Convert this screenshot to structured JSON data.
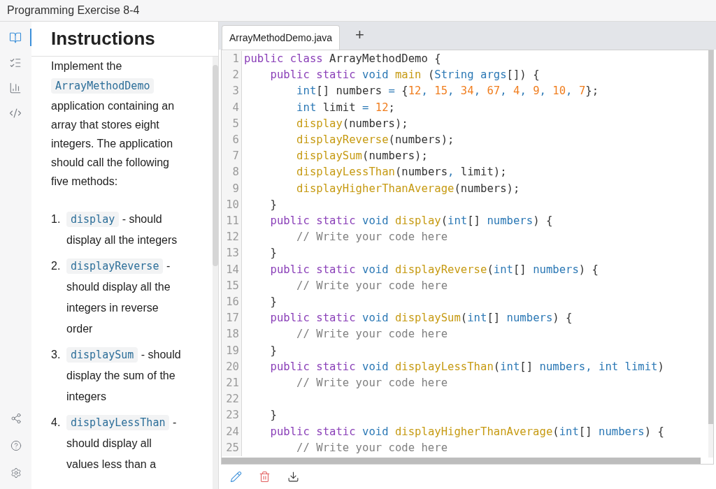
{
  "window": {
    "title": "Programming Exercise 8-4"
  },
  "rail": {
    "top": [
      {
        "selected": true
      },
      {
        "selected": false
      },
      {
        "selected": false
      },
      {
        "selected": false
      }
    ]
  },
  "instructions": {
    "heading": "Instructions",
    "intro_before": "Implement the",
    "intro_code": "ArrayMethodDemo",
    "intro_after": "application containing an array that stores eight integers. The application should call the following five methods:",
    "items": [
      {
        "number": "1.",
        "method": "display",
        "text": "- should display all the integers"
      },
      {
        "number": "2.",
        "method": "displayReverse",
        "text": "- should display all the integers in reverse order"
      },
      {
        "number": "3.",
        "method": "displaySum",
        "text": "- should display the sum of the integers"
      },
      {
        "number": "4.",
        "method": "displayLessThan",
        "text": "- should display all values less than a"
      }
    ]
  },
  "editor": {
    "tabs": [
      {
        "label": "ArrayMethodDemo.java",
        "selected": true
      },
      {
        "label": "+",
        "selected": false
      }
    ],
    "lines": [
      {
        "number": "1",
        "tokens": [
          {
            "kind": "kw",
            "text": "public class "
          },
          {
            "kind": "p",
            "text": "ArrayMethodDemo {"
          }
        ]
      },
      {
        "number": "2",
        "tokens": [
          {
            "kind": "kw",
            "text": "    public static "
          },
          {
            "kind": "type",
            "text": "void "
          },
          {
            "kind": "fn",
            "text": "main "
          },
          {
            "kind": "p",
            "text": "("
          },
          {
            "kind": "type",
            "text": "String args"
          },
          {
            "kind": "p",
            "text": "[]) {"
          }
        ]
      },
      {
        "number": "3",
        "tokens": [
          {
            "kind": "type",
            "text": "        int"
          },
          {
            "kind": "p",
            "text": "[] numbers "
          },
          {
            "kind": "type",
            "text": "= "
          },
          {
            "kind": "p",
            "text": "{"
          },
          {
            "kind": "num",
            "text": "12"
          },
          {
            "kind": "type",
            "text": ", "
          },
          {
            "kind": "num",
            "text": "15"
          },
          {
            "kind": "type",
            "text": ", "
          },
          {
            "kind": "num",
            "text": "34"
          },
          {
            "kind": "type",
            "text": ", "
          },
          {
            "kind": "num",
            "text": "67"
          },
          {
            "kind": "type",
            "text": ", "
          },
          {
            "kind": "num",
            "text": "4"
          },
          {
            "kind": "type",
            "text": ", "
          },
          {
            "kind": "num",
            "text": "9"
          },
          {
            "kind": "type",
            "text": ", "
          },
          {
            "kind": "num",
            "text": "10"
          },
          {
            "kind": "type",
            "text": ", "
          },
          {
            "kind": "num",
            "text": "7"
          },
          {
            "kind": "p",
            "text": "};"
          }
        ]
      },
      {
        "number": "4",
        "tokens": [
          {
            "kind": "type",
            "text": "        int "
          },
          {
            "kind": "p",
            "text": "limit "
          },
          {
            "kind": "type",
            "text": "= "
          },
          {
            "kind": "num",
            "text": "12"
          },
          {
            "kind": "p",
            "text": ";"
          }
        ]
      },
      {
        "number": "5",
        "tokens": [
          {
            "kind": "fn",
            "text": "        display"
          },
          {
            "kind": "p",
            "text": "(numbers);"
          }
        ]
      },
      {
        "number": "6",
        "tokens": [
          {
            "kind": "fn",
            "text": "        displayReverse"
          },
          {
            "kind": "p",
            "text": "(numbers);"
          }
        ]
      },
      {
        "number": "7",
        "tokens": [
          {
            "kind": "fn",
            "text": "        displaySum"
          },
          {
            "kind": "p",
            "text": "(numbers);"
          }
        ]
      },
      {
        "number": "8",
        "tokens": [
          {
            "kind": "fn",
            "text": "        displayLessThan"
          },
          {
            "kind": "p",
            "text": "(numbers"
          },
          {
            "kind": "type",
            "text": ", "
          },
          {
            "kind": "p",
            "text": "limit);"
          }
        ]
      },
      {
        "number": "9",
        "tokens": [
          {
            "kind": "fn",
            "text": "        displayHigherThanAverage"
          },
          {
            "kind": "p",
            "text": "(numbers);"
          }
        ]
      },
      {
        "number": "10",
        "tokens": [
          {
            "kind": "p",
            "text": "    }"
          }
        ]
      },
      {
        "number": "11",
        "tokens": [
          {
            "kind": "kw",
            "text": "    public static "
          },
          {
            "kind": "type",
            "text": "void "
          },
          {
            "kind": "fn",
            "text": "display"
          },
          {
            "kind": "p",
            "text": "("
          },
          {
            "kind": "type",
            "text": "int"
          },
          {
            "kind": "p",
            "text": "[] "
          },
          {
            "kind": "type",
            "text": "numbers"
          },
          {
            "kind": "p",
            "text": ") {"
          }
        ]
      },
      {
        "number": "12",
        "tokens": [
          {
            "kind": "cm",
            "text": "        // Write your code here"
          }
        ]
      },
      {
        "number": "13",
        "tokens": [
          {
            "kind": "p",
            "text": "    }"
          }
        ]
      },
      {
        "number": "14",
        "tokens": [
          {
            "kind": "kw",
            "text": "    public static "
          },
          {
            "kind": "type",
            "text": "void "
          },
          {
            "kind": "fn",
            "text": "displayReverse"
          },
          {
            "kind": "p",
            "text": "("
          },
          {
            "kind": "type",
            "text": "int"
          },
          {
            "kind": "p",
            "text": "[] "
          },
          {
            "kind": "type",
            "text": "numbers"
          },
          {
            "kind": "p",
            "text": ") {"
          }
        ]
      },
      {
        "number": "15",
        "tokens": [
          {
            "kind": "cm",
            "text": "        // Write your code here"
          }
        ]
      },
      {
        "number": "16",
        "tokens": [
          {
            "kind": "p",
            "text": "    }"
          }
        ]
      },
      {
        "number": "17",
        "tokens": [
          {
            "kind": "kw",
            "text": "    public static "
          },
          {
            "kind": "type",
            "text": "void "
          },
          {
            "kind": "fn",
            "text": "displaySum"
          },
          {
            "kind": "p",
            "text": "("
          },
          {
            "kind": "type",
            "text": "int"
          },
          {
            "kind": "p",
            "text": "[] "
          },
          {
            "kind": "type",
            "text": "numbers"
          },
          {
            "kind": "p",
            "text": ") {"
          }
        ]
      },
      {
        "number": "18",
        "tokens": [
          {
            "kind": "cm",
            "text": "        // Write your code here"
          }
        ]
      },
      {
        "number": "19",
        "tokens": [
          {
            "kind": "p",
            "text": "    }"
          }
        ]
      },
      {
        "number": "20",
        "tokens": [
          {
            "kind": "kw",
            "text": "    public static "
          },
          {
            "kind": "type",
            "text": "void "
          },
          {
            "kind": "fn",
            "text": "displayLessThan"
          },
          {
            "kind": "p",
            "text": "("
          },
          {
            "kind": "type",
            "text": "int"
          },
          {
            "kind": "p",
            "text": "[] "
          },
          {
            "kind": "type",
            "text": "numbers, int limit"
          },
          {
            "kind": "p",
            "text": ")"
          }
        ]
      },
      {
        "number": "21",
        "tokens": [
          {
            "kind": "cm",
            "text": "        // Write your code here"
          }
        ]
      },
      {
        "number": "22"
      },
      {
        "number": "23",
        "tokens": [
          {
            "kind": "p",
            "text": "    }"
          }
        ]
      },
      {
        "number": "24",
        "tokens": [
          {
            "kind": "kw",
            "text": "    public static "
          },
          {
            "kind": "type",
            "text": "void "
          },
          {
            "kind": "fn",
            "text": "displayHigherThanAverage"
          },
          {
            "kind": "p",
            "text": "("
          },
          {
            "kind": "type",
            "text": "int"
          },
          {
            "kind": "p",
            "text": "[] "
          },
          {
            "kind": "type",
            "text": "numbers"
          },
          {
            "kind": "p",
            "text": ") {"
          }
        ]
      },
      {
        "number": "25",
        "tokens": [
          {
            "kind": "cm",
            "text": "        // Write your code here"
          }
        ]
      }
    ]
  }
}
